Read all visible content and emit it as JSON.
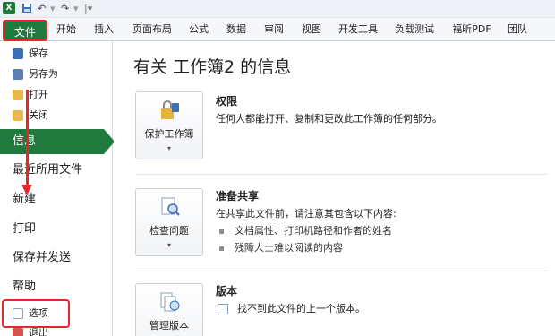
{
  "quick_access": {
    "app_logo": "X",
    "save_icon": "save-icon",
    "undo": "↶",
    "redo": "↷",
    "customize": "|▾"
  },
  "ribbon": {
    "tabs": [
      {
        "label": "文件"
      },
      {
        "label": "开始"
      },
      {
        "label": "插入"
      },
      {
        "label": "页面布局"
      },
      {
        "label": "公式"
      },
      {
        "label": "数据"
      },
      {
        "label": "审阅"
      },
      {
        "label": "视图"
      },
      {
        "label": "开发工具"
      },
      {
        "label": "负载测试"
      },
      {
        "label": "福昕PDF"
      },
      {
        "label": "团队"
      }
    ]
  },
  "backstage_nav": {
    "small_items": [
      {
        "label": "保存",
        "icon": "save-icon"
      },
      {
        "label": "另存为",
        "icon": "save-as-icon"
      },
      {
        "label": "打开",
        "icon": "open-folder-icon"
      },
      {
        "label": "关闭",
        "icon": "close-folder-icon"
      }
    ],
    "big_items": [
      {
        "label": "信息"
      },
      {
        "label": "最近所用文件"
      },
      {
        "label": "新建"
      },
      {
        "label": "打印"
      },
      {
        "label": "保存并发送"
      },
      {
        "label": "帮助"
      }
    ],
    "bottom_items": [
      {
        "label": "选项",
        "icon": "options-icon"
      },
      {
        "label": "退出",
        "icon": "exit-icon"
      }
    ]
  },
  "main": {
    "title": "有关 工作簿2 的信息",
    "sections": [
      {
        "button_label": "保护工作簿",
        "button_icon": "lock-icon",
        "dropdown": "▾",
        "title": "权限",
        "description": "任何人都能打开、复制和更改此工作簿的任何部分。"
      },
      {
        "button_label": "检查问题",
        "button_icon": "inspect-icon",
        "dropdown": "▾",
        "title": "准备共享",
        "description": "在共享此文件前，请注意其包含以下内容:",
        "bullets": [
          "文档属性、打印机路径和作者的姓名",
          "残障人士难以阅读的内容"
        ]
      },
      {
        "button_label": "管理版本",
        "button_icon": "versions-icon",
        "dropdown": "▾",
        "title": "版本",
        "description": "找不到此文件的上一个版本。"
      }
    ]
  },
  "colors": {
    "accent_green": "#207a3e",
    "highlight_red": "#e8262a"
  }
}
